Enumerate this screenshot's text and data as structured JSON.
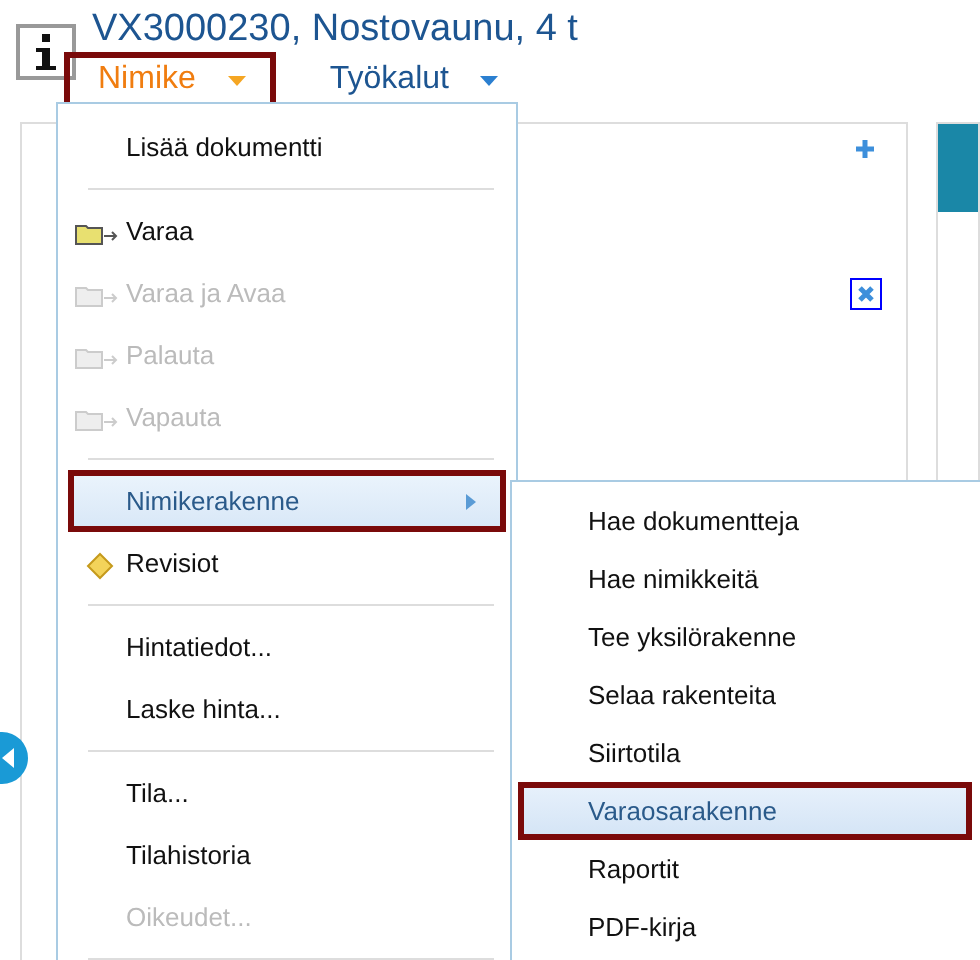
{
  "header": {
    "title": "VX3000230, Nostovaunu, 4 t"
  },
  "menubar": [
    {
      "label": "Nimike",
      "selected": true,
      "highlighted": true
    },
    {
      "label": "Työkalut",
      "selected": false,
      "highlighted": false
    }
  ],
  "menu": [
    {
      "kind": "plain",
      "label": "Lisää dokumentti",
      "disabled": false,
      "selected": false,
      "highlighted": false
    },
    {
      "kind": "separator"
    },
    {
      "kind": "folder",
      "label": "Varaa",
      "disabled": false,
      "selected": false,
      "highlighted": false
    },
    {
      "kind": "folder",
      "label": "Varaa ja Avaa",
      "disabled": true,
      "selected": false,
      "highlighted": false
    },
    {
      "kind": "folder",
      "label": "Palauta",
      "disabled": true,
      "selected": false,
      "highlighted": false
    },
    {
      "kind": "folder",
      "label": "Vapauta",
      "disabled": true,
      "selected": false,
      "highlighted": false
    },
    {
      "kind": "separator"
    },
    {
      "kind": "submenu",
      "label": "Nimikerakenne",
      "disabled": false,
      "selected": true,
      "highlighted": true
    },
    {
      "kind": "revision",
      "label": "Revisiot",
      "disabled": false,
      "selected": false,
      "highlighted": false
    },
    {
      "kind": "separator"
    },
    {
      "kind": "plain",
      "label": "Hintatiedot...",
      "disabled": false,
      "selected": false,
      "highlighted": false
    },
    {
      "kind": "plain",
      "label": "Laske hinta...",
      "disabled": false,
      "selected": false,
      "highlighted": false
    },
    {
      "kind": "separator"
    },
    {
      "kind": "plain",
      "label": "Tila...",
      "disabled": false,
      "selected": false,
      "highlighted": false
    },
    {
      "kind": "plain",
      "label": "Tilahistoria",
      "disabled": false,
      "selected": false,
      "highlighted": false
    },
    {
      "kind": "plain",
      "label": "Oikeudet...",
      "disabled": true,
      "selected": false,
      "highlighted": false
    },
    {
      "kind": "separator"
    }
  ],
  "submenu": [
    {
      "label": "Hae dokumentteja",
      "selected": false,
      "highlighted": false
    },
    {
      "label": "Hae nimikkeitä",
      "selected": false,
      "highlighted": false
    },
    {
      "label": "Tee yksilörakenne",
      "selected": false,
      "highlighted": false
    },
    {
      "label": "Selaa rakenteita",
      "selected": false,
      "highlighted": false
    },
    {
      "label": "Siirtotila",
      "selected": false,
      "highlighted": false
    },
    {
      "label": "Varaosarakenne",
      "selected": true,
      "highlighted": true
    },
    {
      "label": "Raportit",
      "selected": false,
      "highlighted": false
    },
    {
      "label": "PDF-kirja",
      "selected": false,
      "highlighted": false
    }
  ]
}
